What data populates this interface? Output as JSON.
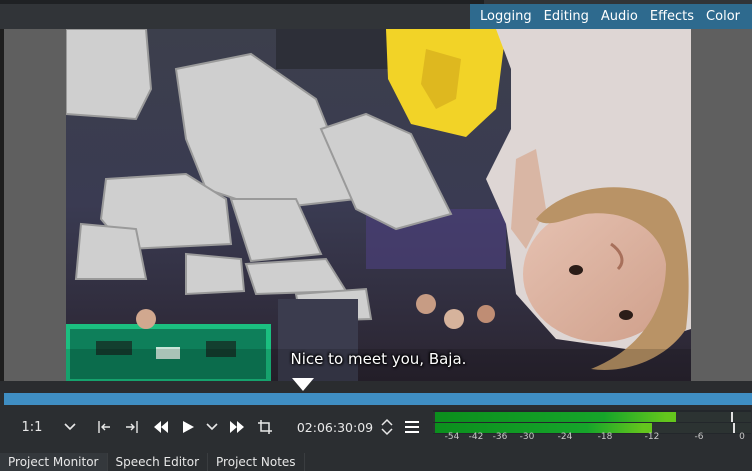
{
  "workspaces": [
    "Logging",
    "Editing",
    "Audio",
    "Effects",
    "Color"
  ],
  "video": {
    "subtitle": "Nice to meet you, Baja."
  },
  "toolbar": {
    "zoom": "1:1",
    "timecode": "02:06:30:09"
  },
  "meter": {
    "scale": [
      "-54",
      "-42",
      "-36",
      "-30",
      "-24",
      "-18",
      "-12",
      "-6",
      "0"
    ],
    "level_top_db": -9,
    "level_bottom_db": -12
  },
  "tabs": [
    "Project Monitor",
    "Speech Editor",
    "Project Notes"
  ],
  "colors": {
    "accent": "#3f8ec3",
    "workspace_bar": "#2e6a8e",
    "meter_green": "#16a52a"
  }
}
